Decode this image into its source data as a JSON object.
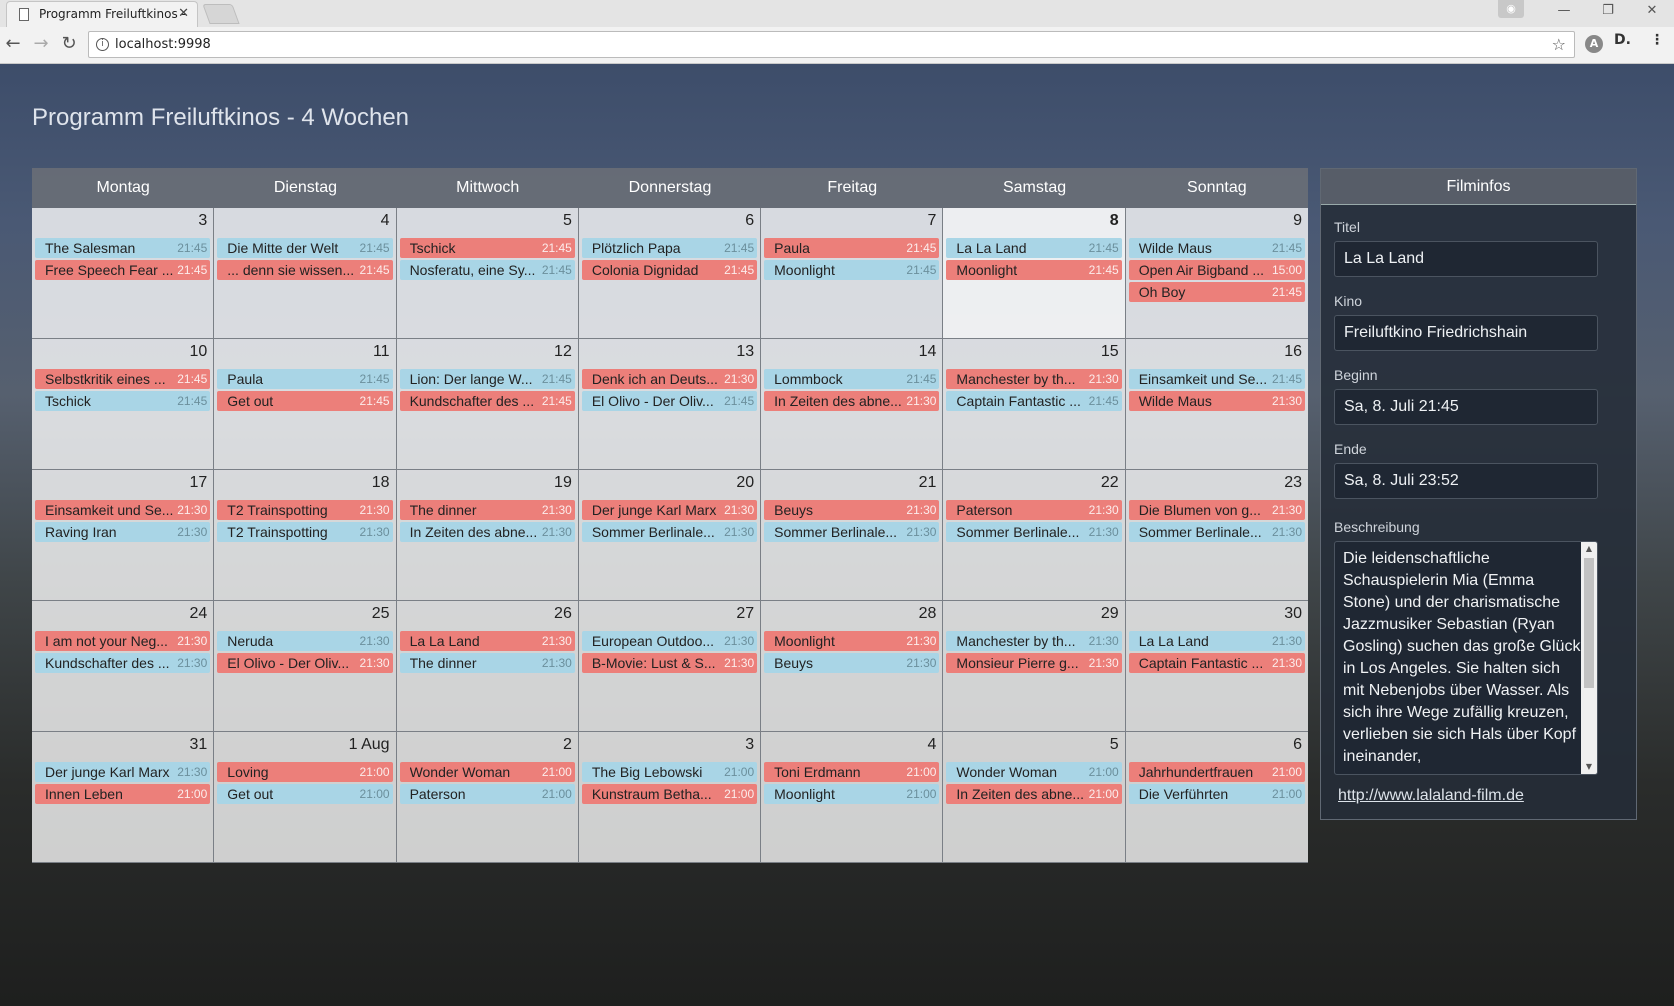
{
  "browser": {
    "tab_title": "Programm Freiluftkinos -",
    "url": "localhost:9998"
  },
  "page": {
    "title": "Programm Freiluftkinos - 4 Wochen"
  },
  "calendar": {
    "weekdays": [
      "Montag",
      "Dienstag",
      "Mittwoch",
      "Donnerstag",
      "Freitag",
      "Samstag",
      "Sonntag"
    ],
    "highlighted_day": "8",
    "weeks": [
      [
        {
          "day": "3",
          "events": [
            {
              "title": "The Salesman",
              "time": "21:45",
              "color": "blue"
            },
            {
              "title": "Free Speech Fear ...",
              "time": "21:45",
              "color": "red"
            }
          ]
        },
        {
          "day": "4",
          "events": [
            {
              "title": "Die Mitte der Welt",
              "time": "21:45",
              "color": "blue"
            },
            {
              "title": "... denn sie wissen...",
              "time": "21:45",
              "color": "red"
            }
          ]
        },
        {
          "day": "5",
          "events": [
            {
              "title": "Tschick",
              "time": "21:45",
              "color": "red"
            },
            {
              "title": "Nosferatu, eine Sy...",
              "time": "21:45",
              "color": "blue"
            }
          ]
        },
        {
          "day": "6",
          "events": [
            {
              "title": "Plötzlich Papa",
              "time": "21:45",
              "color": "blue"
            },
            {
              "title": "Colonia Dignidad",
              "time": "21:45",
              "color": "red"
            }
          ]
        },
        {
          "day": "7",
          "events": [
            {
              "title": "Paula",
              "time": "21:45",
              "color": "red"
            },
            {
              "title": "Moonlight",
              "time": "21:45",
              "color": "blue"
            }
          ]
        },
        {
          "day": "8",
          "events": [
            {
              "title": "La La Land",
              "time": "21:45",
              "color": "blue"
            },
            {
              "title": "Moonlight",
              "time": "21:45",
              "color": "red"
            }
          ]
        },
        {
          "day": "9",
          "events": [
            {
              "title": "Wilde Maus",
              "time": "21:45",
              "color": "blue"
            },
            {
              "title": "Open Air Bigband ...",
              "time": "15:00",
              "color": "red"
            },
            {
              "title": "Oh Boy",
              "time": "21:45",
              "color": "red"
            }
          ]
        }
      ],
      [
        {
          "day": "10",
          "events": [
            {
              "title": "Selbstkritik eines ...",
              "time": "21:45",
              "color": "red"
            },
            {
              "title": "Tschick",
              "time": "21:45",
              "color": "blue"
            }
          ]
        },
        {
          "day": "11",
          "events": [
            {
              "title": "Paula",
              "time": "21:45",
              "color": "blue"
            },
            {
              "title": "Get out",
              "time": "21:45",
              "color": "red"
            }
          ]
        },
        {
          "day": "12",
          "events": [
            {
              "title": "Lion: Der lange W...",
              "time": "21:45",
              "color": "blue"
            },
            {
              "title": "Kundschafter des ...",
              "time": "21:45",
              "color": "red"
            }
          ]
        },
        {
          "day": "13",
          "events": [
            {
              "title": "Denk ich an Deuts...",
              "time": "21:30",
              "color": "red"
            },
            {
              "title": "El Olivo - Der Oliv...",
              "time": "21:45",
              "color": "blue"
            }
          ]
        },
        {
          "day": "14",
          "events": [
            {
              "title": "Lommbock",
              "time": "21:45",
              "color": "blue"
            },
            {
              "title": "In Zeiten des abne...",
              "time": "21:30",
              "color": "red"
            }
          ]
        },
        {
          "day": "15",
          "events": [
            {
              "title": "Manchester by th...",
              "time": "21:30",
              "color": "red"
            },
            {
              "title": "Captain Fantastic ...",
              "time": "21:45",
              "color": "blue"
            }
          ]
        },
        {
          "day": "16",
          "events": [
            {
              "title": "Einsamkeit und Se...",
              "time": "21:45",
              "color": "blue"
            },
            {
              "title": "Wilde Maus",
              "time": "21:30",
              "color": "red"
            }
          ]
        }
      ],
      [
        {
          "day": "17",
          "events": [
            {
              "title": "Einsamkeit und Se...",
              "time": "21:30",
              "color": "red"
            },
            {
              "title": "Raving Iran",
              "time": "21:30",
              "color": "blue"
            }
          ]
        },
        {
          "day": "18",
          "events": [
            {
              "title": "T2 Trainspotting",
              "time": "21:30",
              "color": "red"
            },
            {
              "title": "T2 Trainspotting",
              "time": "21:30",
              "color": "blue"
            }
          ]
        },
        {
          "day": "19",
          "events": [
            {
              "title": "The dinner",
              "time": "21:30",
              "color": "red"
            },
            {
              "title": "In Zeiten des abne...",
              "time": "21:30",
              "color": "blue"
            }
          ]
        },
        {
          "day": "20",
          "events": [
            {
              "title": "Der junge Karl Marx",
              "time": "21:30",
              "color": "red"
            },
            {
              "title": "Sommer Berlinale...",
              "time": "21:30",
              "color": "blue"
            }
          ]
        },
        {
          "day": "21",
          "events": [
            {
              "title": "Beuys",
              "time": "21:30",
              "color": "red"
            },
            {
              "title": "Sommer Berlinale...",
              "time": "21:30",
              "color": "blue"
            }
          ]
        },
        {
          "day": "22",
          "events": [
            {
              "title": "Paterson",
              "time": "21:30",
              "color": "red"
            },
            {
              "title": "Sommer Berlinale...",
              "time": "21:30",
              "color": "blue"
            }
          ]
        },
        {
          "day": "23",
          "events": [
            {
              "title": "Die Blumen von g...",
              "time": "21:30",
              "color": "red"
            },
            {
              "title": "Sommer Berlinale...",
              "time": "21:30",
              "color": "blue"
            }
          ]
        }
      ],
      [
        {
          "day": "24",
          "events": [
            {
              "title": "I am not your Neg...",
              "time": "21:30",
              "color": "red"
            },
            {
              "title": "Kundschafter des ...",
              "time": "21:30",
              "color": "blue"
            }
          ]
        },
        {
          "day": "25",
          "events": [
            {
              "title": "Neruda",
              "time": "21:30",
              "color": "blue"
            },
            {
              "title": "El Olivo - Der Oliv...",
              "time": "21:30",
              "color": "red"
            }
          ]
        },
        {
          "day": "26",
          "events": [
            {
              "title": "La La Land",
              "time": "21:30",
              "color": "red"
            },
            {
              "title": "The dinner",
              "time": "21:30",
              "color": "blue"
            }
          ]
        },
        {
          "day": "27",
          "events": [
            {
              "title": "European Outdoo...",
              "time": "21:30",
              "color": "blue"
            },
            {
              "title": "B-Movie: Lust & S...",
              "time": "21:30",
              "color": "red"
            }
          ]
        },
        {
          "day": "28",
          "events": [
            {
              "title": "Moonlight",
              "time": "21:30",
              "color": "red"
            },
            {
              "title": "Beuys",
              "time": "21:30",
              "color": "blue"
            }
          ]
        },
        {
          "day": "29",
          "events": [
            {
              "title": "Manchester by th...",
              "time": "21:30",
              "color": "blue"
            },
            {
              "title": "Monsieur Pierre g...",
              "time": "21:30",
              "color": "red"
            }
          ]
        },
        {
          "day": "30",
          "events": [
            {
              "title": "La La Land",
              "time": "21:30",
              "color": "blue"
            },
            {
              "title": "Captain Fantastic ...",
              "time": "21:30",
              "color": "red"
            }
          ]
        }
      ],
      [
        {
          "day": "31",
          "events": [
            {
              "title": "Der junge Karl Marx",
              "time": "21:30",
              "color": "blue"
            },
            {
              "title": "Innen Leben",
              "time": "21:00",
              "color": "red"
            }
          ]
        },
        {
          "day": "1 Aug",
          "events": [
            {
              "title": "Loving",
              "time": "21:00",
              "color": "red"
            },
            {
              "title": "Get out",
              "time": "21:00",
              "color": "blue"
            }
          ]
        },
        {
          "day": "2",
          "events": [
            {
              "title": "Wonder Woman",
              "time": "21:00",
              "color": "red"
            },
            {
              "title": "Paterson",
              "time": "21:00",
              "color": "blue"
            }
          ]
        },
        {
          "day": "3",
          "events": [
            {
              "title": "The Big Lebowski",
              "time": "21:00",
              "color": "blue"
            },
            {
              "title": "Kunstraum Betha...",
              "time": "21:00",
              "color": "red"
            }
          ]
        },
        {
          "day": "4",
          "events": [
            {
              "title": "Toni Erdmann",
              "time": "21:00",
              "color": "red"
            },
            {
              "title": "Moonlight",
              "time": "21:00",
              "color": "blue"
            }
          ]
        },
        {
          "day": "5",
          "events": [
            {
              "title": "Wonder Woman",
              "time": "21:00",
              "color": "blue"
            },
            {
              "title": "In Zeiten des abne...",
              "time": "21:00",
              "color": "red"
            }
          ]
        },
        {
          "day": "6",
          "events": [
            {
              "title": "Jahrhundertfrauen",
              "time": "21:00",
              "color": "red"
            },
            {
              "title": "Die Verführten",
              "time": "21:00",
              "color": "blue"
            }
          ]
        }
      ]
    ]
  },
  "filminfo": {
    "header": "Filminfos",
    "title_label": "Titel",
    "title_value": "La La Land",
    "kino_label": "Kino",
    "kino_value": "Freiluftkino Friedrichshain",
    "beginn_label": "Beginn",
    "beginn_value": "Sa, 8. Juli 21:45",
    "ende_label": "Ende",
    "ende_value": "Sa, 8. Juli 23:52",
    "beschreibung_label": "Beschreibung",
    "beschreibung_value": "Die leidenschaftliche Schauspielerin Mia (Emma Stone) und der charismatische Jazzmusiker Sebastian (Ryan Gosling) suchen das große Glück in Los Angeles. Sie halten sich mit Nebenjobs über Wasser. Als sich ihre Wege zufällig kreuzen, verlieben sie sich Hals über Kopf ineinander,",
    "link": "http://www.lalaland-film.de"
  },
  "colors": {
    "red": "#ec7f7a",
    "blue": "#a9d5e6"
  }
}
